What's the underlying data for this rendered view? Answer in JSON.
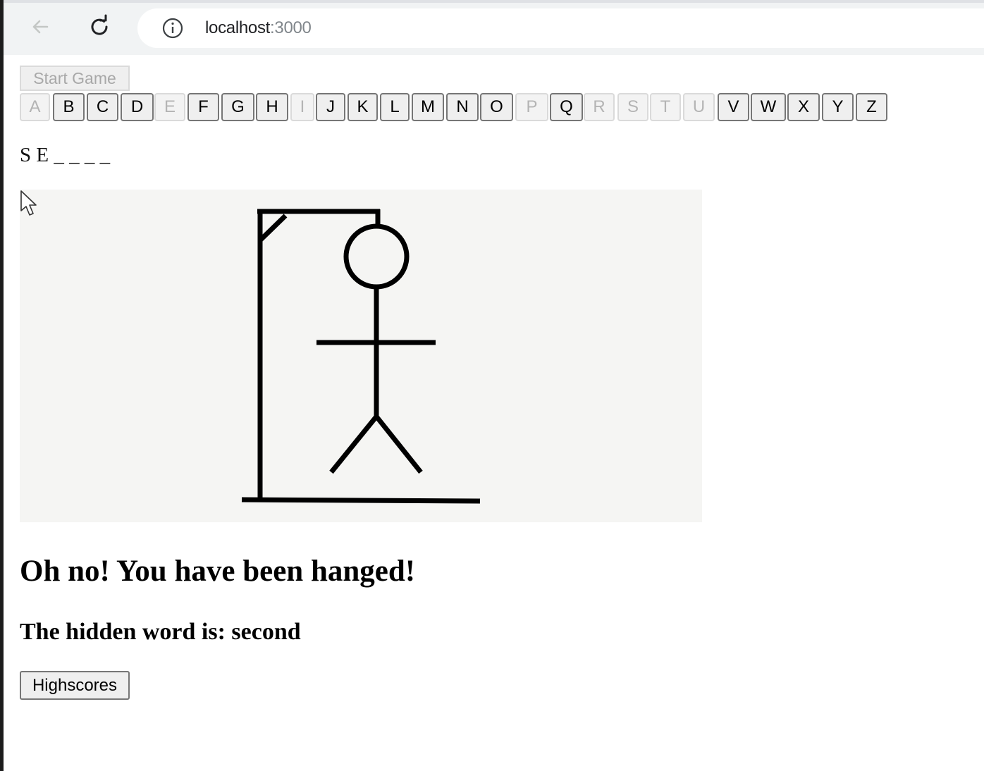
{
  "browser": {
    "url_host": "localhost",
    "url_port": ":3000",
    "icons": [
      "back-arrow-icon",
      "reload-icon",
      "info-icon"
    ]
  },
  "game": {
    "start_label": "Start Game",
    "letters": [
      {
        "char": "A",
        "enabled": false
      },
      {
        "char": "B",
        "enabled": true
      },
      {
        "char": "C",
        "enabled": true
      },
      {
        "char": "D",
        "enabled": true
      },
      {
        "char": "E",
        "enabled": false
      },
      {
        "char": "F",
        "enabled": true
      },
      {
        "char": "G",
        "enabled": true
      },
      {
        "char": "H",
        "enabled": true
      },
      {
        "char": "I",
        "enabled": false
      },
      {
        "char": "J",
        "enabled": true
      },
      {
        "char": "K",
        "enabled": true
      },
      {
        "char": "L",
        "enabled": true
      },
      {
        "char": "M",
        "enabled": true
      },
      {
        "char": "N",
        "enabled": true
      },
      {
        "char": "O",
        "enabled": true
      },
      {
        "char": "P",
        "enabled": false
      },
      {
        "char": "Q",
        "enabled": true
      },
      {
        "char": "R",
        "enabled": false
      },
      {
        "char": "S",
        "enabled": false
      },
      {
        "char": "T",
        "enabled": false
      },
      {
        "char": "U",
        "enabled": false
      },
      {
        "char": "V",
        "enabled": true
      },
      {
        "char": "W",
        "enabled": true
      },
      {
        "char": "X",
        "enabled": true
      },
      {
        "char": "Y",
        "enabled": true
      },
      {
        "char": "Z",
        "enabled": true
      }
    ],
    "word_display": "S E _ _ _ _",
    "result_message": "Oh no! You have been hanged!",
    "hidden_word_text": "The hidden word is: second",
    "highscores_label": "Highscores"
  },
  "colors": {
    "drawing_background": "#f5f5f3",
    "stroke": "#000000",
    "disabled_text": "#b4b4b4"
  }
}
